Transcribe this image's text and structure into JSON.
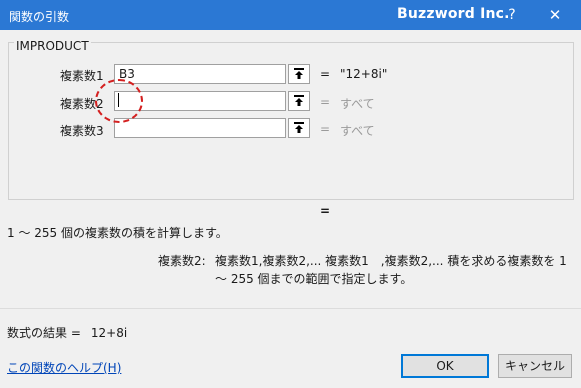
{
  "window": {
    "title": "関数の引数",
    "brand": "Buzzword Inc.",
    "help_label": "?",
    "close_label": "✕"
  },
  "function": {
    "name": "IMPRODUCT",
    "args": [
      {
        "label": "複素数1",
        "value": "B3",
        "result": "\"12+8i\""
      },
      {
        "label": "複素数2",
        "value": "",
        "result": "すべて"
      },
      {
        "label": "複素数3",
        "value": "",
        "result": "すべて"
      }
    ],
    "eq_sign": "=",
    "result_eq": "=",
    "description": "1 ～ 255 個の複素数の積を計算します。",
    "arg_desc_label": "複素数2:",
    "arg_desc_text": "複素数1,複素数2,... 複素数1　,複素数2,... 積を求める複素数を 1 ～ 255 個までの範囲で指定します。"
  },
  "formula_result": {
    "label": "数式の結果 =",
    "value": "12+8i"
  },
  "footer": {
    "help_link": "この関数のヘルプ(H)",
    "ok_label": "OK",
    "cancel_label": "キャンセル"
  },
  "colors": {
    "titlebar": "#2b78d4",
    "focus_circle": "#d42020",
    "link": "#0045b8"
  },
  "icons": [
    "collapse-dialog-icon",
    "help-icon",
    "close-icon"
  ]
}
